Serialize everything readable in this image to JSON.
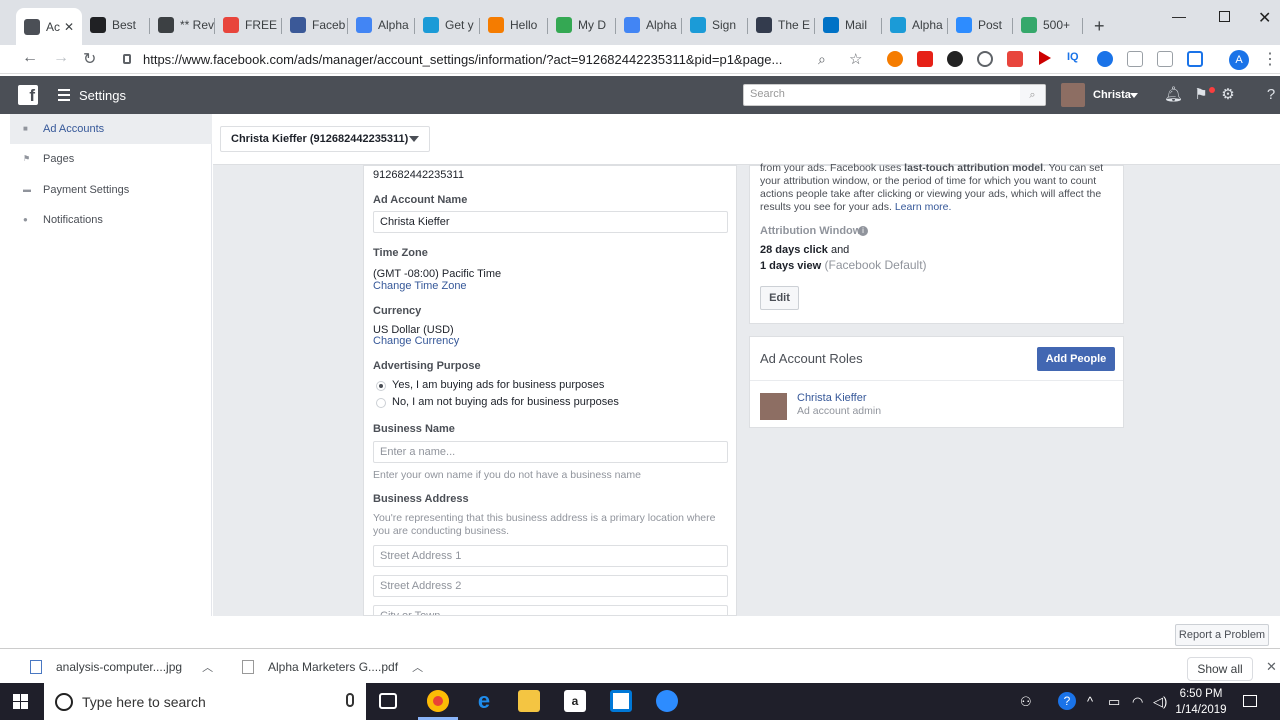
{
  "browser": {
    "tabs": [
      {
        "label": "Ac",
        "color": "#4b4f56",
        "active": true
      },
      {
        "label": "Best",
        "color": "#202124"
      },
      {
        "label": "** Rev",
        "color": "#3c4043"
      },
      {
        "label": "FREE",
        "color": "#e8453c"
      },
      {
        "label": "Faceb",
        "color": "#3b5998"
      },
      {
        "label": "Alpha",
        "color": "#4285f4"
      },
      {
        "label": "Get y",
        "color": "#1b9bd7"
      },
      {
        "label": "Hello",
        "color": "#f57c00"
      },
      {
        "label": "My D",
        "color": "#34a853"
      },
      {
        "label": "Alpha",
        "color": "#4285f4"
      },
      {
        "label": "Sign",
        "color": "#1b9bd7"
      },
      {
        "label": "The E",
        "color": "#333b4d"
      },
      {
        "label": "Mail",
        "color": "#0072c6"
      },
      {
        "label": "Alpha",
        "color": "#1b9bd7"
      },
      {
        "label": "Post",
        "color": "#2d8cff"
      },
      {
        "label": "500+",
        "color": "#35a86b"
      }
    ],
    "url": "https://www.facebook.com/ads/manager/account_settings/information/?act=912682442235311&pid=p1&page...",
    "avatar_letter": "A"
  },
  "fb": {
    "title": "Settings",
    "search_placeholder": "Search",
    "user_name": "Christa"
  },
  "sidebar": {
    "items": [
      {
        "label": "Ad Accounts",
        "icon": "ad-accounts-icon"
      },
      {
        "label": "Pages",
        "icon": "flag-icon"
      },
      {
        "label": "Payment Settings",
        "icon": "card-icon"
      },
      {
        "label": "Notifications",
        "icon": "globe-icon"
      }
    ]
  },
  "account_selector": "Christa Kieffer (912682442235311)",
  "form": {
    "account_id": "912682442235311",
    "ad_account_name_label": "Ad Account Name",
    "ad_account_name_value": "Christa Kieffer",
    "time_zone_label": "Time Zone",
    "time_zone_value": "(GMT -08:00) Pacific Time",
    "change_time_zone": "Change Time Zone",
    "currency_label": "Currency",
    "currency_value": "US Dollar (USD)",
    "change_currency": "Change Currency",
    "purpose_label": "Advertising Purpose",
    "purpose_yes": "Yes, I am buying ads for business purposes",
    "purpose_no": "No, I am not buying ads for business purposes",
    "business_name_label": "Business Name",
    "business_name_placeholder": "Enter a name...",
    "business_name_hint": "Enter your own name if you do not have a business name",
    "business_address_label": "Business Address",
    "business_address_hint": "You're representing that this business address is a primary location where you are conducting business.",
    "street1_placeholder": "Street Address 1",
    "street2_placeholder": "Street Address 2",
    "city_placeholder": "City or Town"
  },
  "attribution": {
    "text_pre": "from your ads. Facebook uses ",
    "text_bold": "last-touch attribution model",
    "text_post": ". You can set your attribution window, or the period of time for which you want to count actions people take after clicking or viewing your ads, which will affect the results you see for your ads. ",
    "learn_more": "Learn more.",
    "window_label": "Attribution Window",
    "click_bold": "28 days click",
    "click_and": " and",
    "view_bold": "1 days view",
    "view_default": " (Facebook Default)",
    "edit_label": "Edit"
  },
  "roles": {
    "title": "Ad Account Roles",
    "add_people": "Add People",
    "person_name": "Christa Kieffer",
    "person_role": "Ad account admin"
  },
  "report_problem": "Report a Problem",
  "downloads": {
    "items": [
      "analysis-computer....jpg",
      "Alpha Marketers G....pdf"
    ],
    "show_all": "Show all"
  },
  "taskbar": {
    "search_placeholder": "Type here to search",
    "time": "6:50 PM",
    "date": "1/14/2019"
  }
}
